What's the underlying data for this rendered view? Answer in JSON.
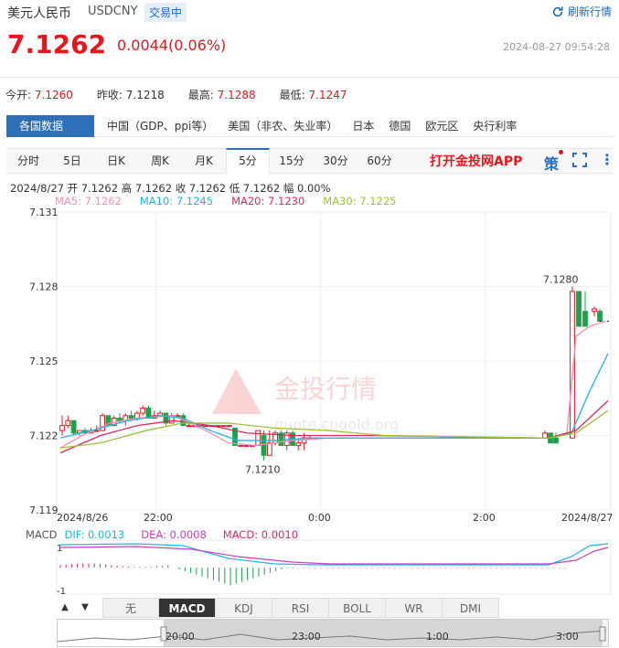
{
  "header": {
    "title": "美元人民币",
    "symbol": "USDCNY",
    "status": "交易中",
    "refresh_label": "刷新行情"
  },
  "quote": {
    "price": "7.1262",
    "change": "0.0044(0.06%)",
    "datetime": "2024-08-27 09:54:28",
    "open_label": "今开:",
    "open": "7.1260",
    "prev_label": "昨收:",
    "prev": "7.1218",
    "high_label": "最高:",
    "high": "7.1288",
    "low_label": "最低:",
    "low": "7.1247"
  },
  "indicator_tabs": {
    "main": "各国数据",
    "items": [
      "中国（GDP、ppi等）",
      "美国（非农、失业率）",
      "日本",
      "德国",
      "欧元区",
      "央行利率"
    ]
  },
  "periods": {
    "items": [
      "分时",
      "5日",
      "日K",
      "周K",
      "月K",
      "5分",
      "15分",
      "30分",
      "60分"
    ],
    "active": "5分",
    "app_link": "打开金投网APP",
    "strategy": "策"
  },
  "info": {
    "ohlc": "2024/8/27  开 7.1262  高 7.1262  收 7.1262  低 7.1262  幅 0.00%",
    "ma5": "MA5: 7.1262",
    "ma10": "MA10: 7.1245",
    "ma20": "MA20: 7.1230",
    "ma30": "MA30: 7.1225"
  },
  "macd": {
    "label": "MACD",
    "dif": "DIF: 0.0013",
    "dea": "DEA: 0.0008",
    "macd": "MACD: 0.0010",
    "axis_top": "1",
    "axis_bottom": "-1"
  },
  "bottom_tabs": {
    "up": "▲",
    "down": "▼",
    "items": [
      "无",
      "MACD",
      "KDJ",
      "RSI",
      "BOLL",
      "WR",
      "DMI"
    ],
    "active": "MACD"
  },
  "navigator": {
    "labels": [
      "20:00",
      "23:00",
      "1:00",
      "3:00"
    ]
  },
  "colors": {
    "up": "#e4161e",
    "down": "#1aa34a",
    "ma5": "#f28fb0",
    "ma10": "#1fb6e0",
    "ma20": "#d62a5e",
    "ma30": "#9ec13a"
  },
  "chart_data": {
    "type": "candlestick",
    "y_ticks": [
      "7.131",
      "7.128",
      "7.125",
      "7.122",
      "7.119"
    ],
    "ylim": [
      7.119,
      7.131
    ],
    "x_ticks": [
      "2024/8/26",
      "22:00",
      "0:00",
      "2:00",
      "2024/8/27"
    ],
    "high_annotation": "7.1280",
    "low_annotation": "7.1210",
    "watermark": "金投行情",
    "watermark_sub": "quote.cngold.org",
    "candles": [
      [
        7.1222,
        7.1228,
        7.122,
        7.1224
      ],
      [
        7.1224,
        7.1228,
        7.1223,
        7.1226
      ],
      [
        7.1226,
        7.1226,
        7.122,
        7.1221
      ],
      [
        7.1221,
        7.1222,
        7.122,
        7.1222
      ],
      [
        7.1222,
        7.1223,
        7.1221,
        7.1221
      ],
      [
        7.1221,
        7.1223,
        7.1221,
        7.1222
      ],
      [
        7.1222,
        7.1224,
        7.1222,
        7.1222
      ],
      [
        7.1222,
        7.1229,
        7.1222,
        7.1228
      ],
      [
        7.1228,
        7.1228,
        7.1224,
        7.1224
      ],
      [
        7.1224,
        7.1228,
        7.1224,
        7.1227
      ],
      [
        7.1227,
        7.1229,
        7.1225,
        7.1226
      ],
      [
        7.1226,
        7.1229,
        7.1224,
        7.1228
      ],
      [
        7.1228,
        7.123,
        7.1226,
        7.1227
      ],
      [
        7.1227,
        7.123,
        7.1226,
        7.1229
      ],
      [
        7.1229,
        7.1232,
        7.1228,
        7.1231
      ],
      [
        7.1231,
        7.1232,
        7.1227,
        7.1227
      ],
      [
        7.1227,
        7.123,
        7.1227,
        7.1228
      ],
      [
        7.1228,
        7.123,
        7.1228,
        7.1229
      ],
      [
        7.1229,
        7.1229,
        7.1224,
        7.1225
      ],
      [
        7.1225,
        7.1229,
        7.1225,
        7.1228
      ],
      [
        7.1228,
        7.1229,
        7.1227,
        7.1228
      ],
      [
        7.1228,
        7.1229,
        7.1224,
        7.1224
      ],
      [
        7.1224,
        7.1225,
        7.1224,
        7.1224
      ],
      [
        7.1224,
        7.1224,
        7.1224,
        7.1224
      ],
      [
        7.1224,
        7.1224,
        7.1224,
        7.1224
      ],
      [
        7.1224,
        7.1224,
        7.1224,
        7.1224
      ],
      [
        7.1224,
        7.1224,
        7.1224,
        7.1224
      ],
      [
        7.1224,
        7.1224,
        7.1224,
        7.1224
      ],
      [
        7.1224,
        7.1224,
        7.1224,
        7.1224
      ],
      [
        7.1224,
        7.1224,
        7.1224,
        7.1224
      ],
      [
        7.1223,
        7.1223,
        7.1216,
        7.1216
      ],
      [
        7.1216,
        7.1216,
        7.1216,
        7.1216
      ],
      [
        7.1216,
        7.1216,
        7.1216,
        7.1216
      ],
      [
        7.1216,
        7.1216,
        7.1216,
        7.1216
      ],
      [
        7.1216,
        7.1222,
        7.1216,
        7.1222
      ],
      [
        7.122,
        7.1222,
        7.121,
        7.1212
      ],
      [
        7.1212,
        7.1222,
        7.1212,
        7.1217
      ],
      [
        7.1217,
        7.1222,
        7.1216,
        7.1221
      ],
      [
        7.1221,
        7.1222,
        7.1216,
        7.1216
      ],
      [
        7.1216,
        7.1222,
        7.1214,
        7.1221
      ],
      [
        7.1221,
        7.1222,
        7.1216,
        7.1216
      ],
      [
        7.1216,
        7.1219,
        7.1214,
        7.1217
      ],
      [
        7.1217,
        7.1221,
        7.1214,
        7.1219
      ],
      [
        7.1219,
        7.122,
        7.1219,
        7.1219
      ],
      [
        7.1219,
        7.1219,
        7.1219,
        7.1219
      ]
    ]
  }
}
